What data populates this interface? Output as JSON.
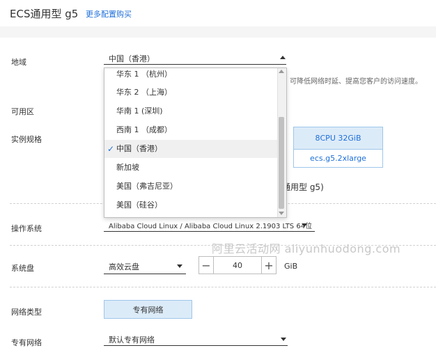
{
  "header": {
    "title": "ECS通用型 g5",
    "more_link": "更多配置购买"
  },
  "region": {
    "label": "地域",
    "value": "中国（香港）",
    "hint": "，可降低网络时延、提高您客户的访问速度。",
    "options": [
      {
        "label": "华东 1 （杭州）",
        "selected": false
      },
      {
        "label": "华东 2 （上海）",
        "selected": false
      },
      {
        "label": "华南 1 (深圳)",
        "selected": false
      },
      {
        "label": "西南 1 （成都）",
        "selected": false
      },
      {
        "label": "中国（香港）",
        "selected": true
      },
      {
        "label": "新加坡",
        "selected": false
      },
      {
        "label": "美国（弗吉尼亚）",
        "selected": false
      },
      {
        "label": "美国（硅谷）",
        "selected": false
      }
    ]
  },
  "zone": {
    "label": "可用区"
  },
  "instance": {
    "label": "实例规格",
    "spec": "8CPU 32GiB",
    "type_name": "ecs.g5.2xlarge",
    "family_text": "通用型 g5)"
  },
  "os": {
    "label": "操作系统",
    "value": "Alibaba Cloud Linux / Alibaba Cloud Linux 2.1903 LTS 64位"
  },
  "watermark": "阿里云活动网  aliyunhuodong.com",
  "disk": {
    "label": "系统盘",
    "type": "高效云盘",
    "size": "40",
    "unit": "GiB",
    "minus": "−",
    "plus": "+"
  },
  "network_type": {
    "label": "网络类型",
    "value": "专有网络"
  },
  "vpc": {
    "label": "专有网络",
    "value": "默认专有网络"
  },
  "colors": {
    "accent": "#1e6fd9",
    "selected_bg": "#dcebf8",
    "border_blue": "#9ec6ea"
  }
}
